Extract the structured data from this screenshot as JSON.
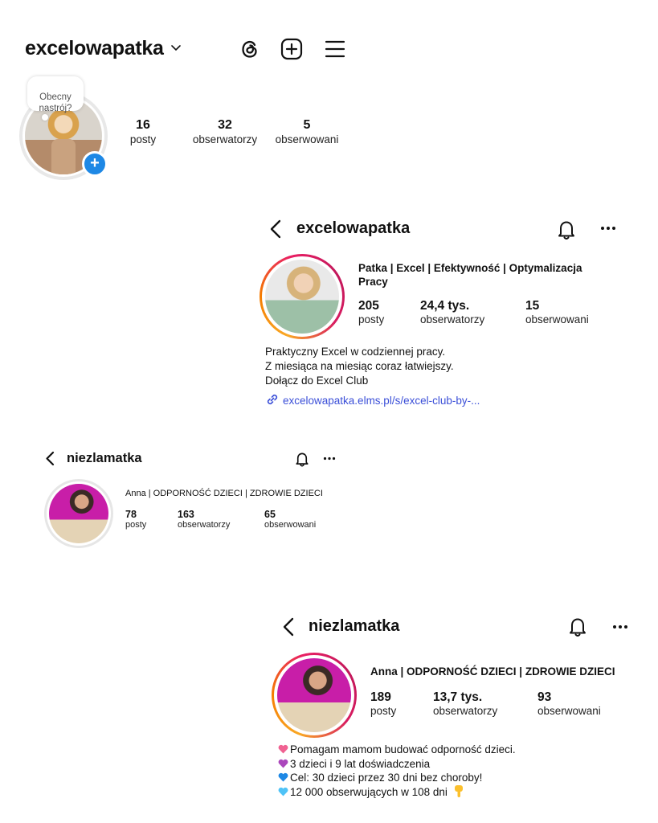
{
  "p1": {
    "username": "excelowapatka",
    "mood_bubble": "Obecny\nnastrój?",
    "stats": [
      {
        "value": "16",
        "label": "posty"
      },
      {
        "value": "32",
        "label": "obserwatorzy"
      },
      {
        "value": "5",
        "label": "obserwowani"
      }
    ]
  },
  "p2": {
    "username": "excelowapatka",
    "name": "Patka | Excel | Efektywność | Optymalizacja Pracy",
    "stats": [
      {
        "value": "205",
        "label": "posty"
      },
      {
        "value": "24,4 tys.",
        "label": "obserwatorzy"
      },
      {
        "value": "15",
        "label": "obserwowani"
      }
    ],
    "bio": [
      "Praktyczny Excel w codziennej pracy.",
      "Z miesiąca na miesiąc coraz łatwiejszy.",
      "Dołącz do Excel Club"
    ],
    "link": "excelowapatka.elms.pl/s/excel-club-by-..."
  },
  "p3": {
    "username": "niezlamatka",
    "name": "Anna | ODPORNOŚĆ DZIECI | ZDROWIE DZIECI",
    "stats": [
      {
        "value": "78",
        "label": "posty"
      },
      {
        "value": "163",
        "label": "obserwatorzy"
      },
      {
        "value": "65",
        "label": "obserwowani"
      }
    ]
  },
  "p4": {
    "username": "niezlamatka",
    "name": "Anna | ODPORNOŚĆ DZIECI | ZDROWIE DZIECI",
    "stats": [
      {
        "value": "189",
        "label": "posty"
      },
      {
        "value": "13,7 tys.",
        "label": "obserwatorzy"
      },
      {
        "value": "93",
        "label": "obserwowani"
      }
    ],
    "bio": [
      {
        "text": "Pomagam mamom budować odporność dzieci.",
        "heart_color": "#f06292"
      },
      {
        "text": "3 dzieci i 9 lat doświadczenia",
        "heart_color": "#ab47bc"
      },
      {
        "text": "Cel: 30 dzieci przez 30 dni bez choroby!",
        "heart_color": "#1e88e5"
      },
      {
        "text": "12 000 obserwujących w 108 dni",
        "heart_color": "#4fc3f7"
      }
    ]
  }
}
